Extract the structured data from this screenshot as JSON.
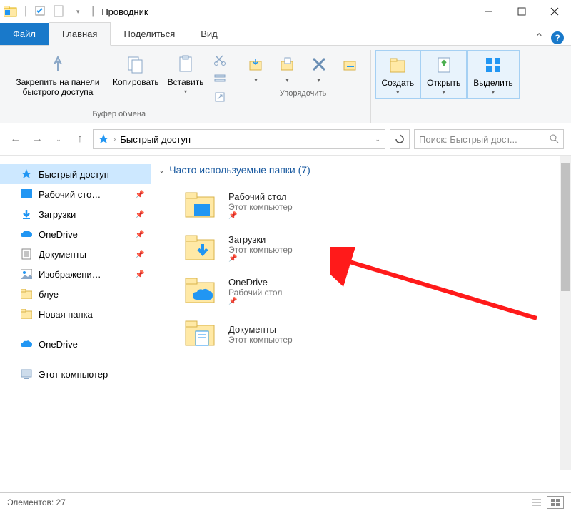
{
  "title": "Проводник",
  "tabs": {
    "file": "Файл",
    "home": "Главная",
    "share": "Поделиться",
    "view": "Вид"
  },
  "ribbon": {
    "pin": "Закрепить на панели быстрого доступа",
    "copy": "Копировать",
    "paste": "Вставить",
    "group_clipboard": "Буфер обмена",
    "group_organize": "Упорядочить",
    "create": "Создать",
    "open": "Открыть",
    "select": "Выделить"
  },
  "address": {
    "root": "Быстрый доступ"
  },
  "search": {
    "placeholder": "Поиск: Быстрый дост..."
  },
  "nav": [
    {
      "label": "Быстрый доступ",
      "icon": "star",
      "selected": true
    },
    {
      "label": "Рабочий сто…",
      "icon": "desktop",
      "pin": true
    },
    {
      "label": "Загрузки",
      "icon": "downloads",
      "pin": true
    },
    {
      "label": "OneDrive",
      "icon": "onedrive",
      "pin": true
    },
    {
      "label": "Документы",
      "icon": "documents",
      "pin": true
    },
    {
      "label": "Изображени…",
      "icon": "pictures",
      "pin": true
    },
    {
      "label": "блуе",
      "icon": "folder",
      "pin": false
    },
    {
      "label": "Новая папка",
      "icon": "folder",
      "pin": false
    }
  ],
  "nav2": [
    {
      "label": "OneDrive",
      "icon": "onedrive"
    },
    {
      "label": "Этот компьютер",
      "icon": "computer"
    }
  ],
  "content": {
    "section_title": "Часто используемые папки (7)",
    "items": [
      {
        "name": "Рабочий стол",
        "sub": "Этот компьютер",
        "type": "desktop"
      },
      {
        "name": "Загрузки",
        "sub": "Этот компьютер",
        "type": "downloads"
      },
      {
        "name": "OneDrive",
        "sub": "Рабочий стол",
        "type": "onedrive"
      },
      {
        "name": "Документы",
        "sub": "Этот компьютер",
        "type": "documents"
      }
    ]
  },
  "statusbar": {
    "elements_label": "Элементов:",
    "count": "27"
  }
}
